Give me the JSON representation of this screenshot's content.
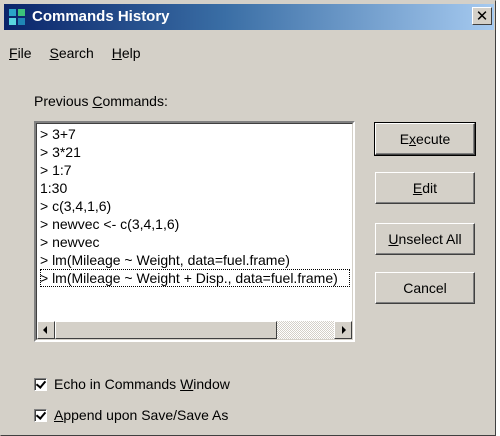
{
  "window": {
    "title": "Commands History"
  },
  "menu": [
    {
      "pre": "",
      "key": "F",
      "post": "ile"
    },
    {
      "pre": "",
      "key": "S",
      "post": "earch"
    },
    {
      "pre": "",
      "key": "H",
      "post": "elp"
    }
  ],
  "previous": {
    "pre": "Previous ",
    "key": "C",
    "post": "ommands:"
  },
  "commands": [
    "> 3+7",
    "> 3*21",
    "> 1:7",
    "1:30",
    "> c(3,4,1,6)",
    "> newvec <- c(3,4,1,6)",
    "> newvec",
    "> lm(Mileage ~ Weight, data=fuel.frame)",
    "> lm(Mileage ~ Weight + Disp., data=fuel.frame)"
  ],
  "buttons": {
    "execute": {
      "pre": "E",
      "key": "x",
      "post": "ecute"
    },
    "edit": {
      "pre": "",
      "key": "E",
      "post": "dit"
    },
    "unselect": {
      "pre": "",
      "key": "U",
      "post": "nselect All"
    },
    "cancel": {
      "pre": "Cancel",
      "key": "",
      "post": ""
    }
  },
  "options": {
    "echo": {
      "checked": true,
      "pre": "Echo in Commands ",
      "key": "W",
      "post": "indow"
    },
    "append": {
      "checked": true,
      "pre": "",
      "key": "A",
      "post": "ppend upon Save/Save As"
    }
  },
  "icons": {
    "app": "commands-history-icon",
    "close": "close-icon",
    "scroll_left": "arrow-left-icon",
    "scroll_right": "arrow-right-icon",
    "check": "check-icon"
  }
}
